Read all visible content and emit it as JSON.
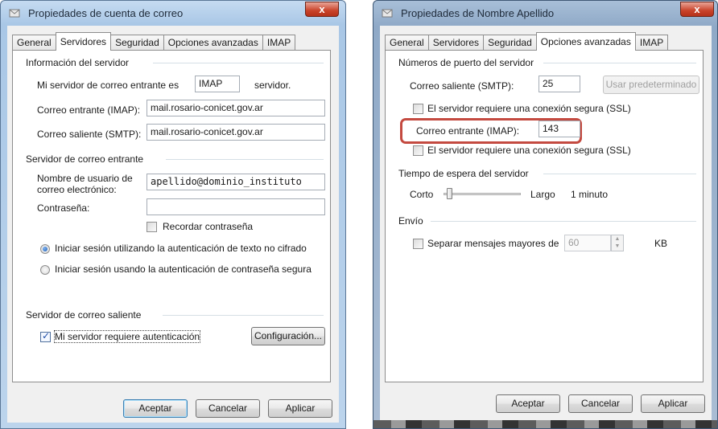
{
  "left_window": {
    "title": "Propiedades de cuenta de correo",
    "close_glyph": "x",
    "tabs": [
      {
        "label": "General",
        "active": false
      },
      {
        "label": "Servidores",
        "active": true
      },
      {
        "label": "Seguridad",
        "active": false
      },
      {
        "label": "Opciones avanzadas",
        "active": false
      },
      {
        "label": "IMAP",
        "active": false
      }
    ],
    "server_info_group": "Información del servidor",
    "incoming_type_label": "Mi servidor de correo entrante es",
    "incoming_type_value": "IMAP",
    "incoming_type_suffix": "servidor.",
    "incoming_imap_label": "Correo entrante (IMAP):",
    "incoming_imap_value": "mail.rosario-conicet.gov.ar",
    "outgoing_smtp_label": "Correo saliente (SMTP):",
    "outgoing_smtp_value": "mail.rosario-conicet.gov.ar",
    "incoming_server_group": "Servidor de correo entrante",
    "username_label_1": "Nombre de usuario de",
    "username_label_2": "correo electrónico:",
    "username_value": "apellido@dominio_instituto",
    "password_label": "Contraseña:",
    "password_value": "",
    "remember_password_label": "Recordar contraseña",
    "remember_password_checked": false,
    "radio_plain_label": "Iniciar sesión utilizando la autenticación de texto no cifrado",
    "radio_plain_selected": true,
    "radio_secure_label": "Iniciar sesión usando la autenticación de contraseña segura",
    "radio_secure_selected": false,
    "outgoing_server_group": "Servidor de correo saliente",
    "requires_auth_label": "Mi servidor requiere autenticación",
    "requires_auth_checked": true,
    "config_button": "Configuración...",
    "ok_button": "Aceptar",
    "cancel_button": "Cancelar",
    "apply_button": "Aplicar"
  },
  "right_window": {
    "title": "Propiedades de Nombre Apellido",
    "close_glyph": "x",
    "tabs": [
      {
        "label": "General",
        "active": false
      },
      {
        "label": "Servidores",
        "active": false
      },
      {
        "label": "Seguridad",
        "active": false
      },
      {
        "label": "Opciones avanzadas",
        "active": true
      },
      {
        "label": "IMAP",
        "active": false
      }
    ],
    "ports_group": "Números de puerto del servidor",
    "smtp_label": "Correo saliente (SMTP):",
    "smtp_port": "25",
    "use_default_button": "Usar predeterminado",
    "smtp_ssl_label": "El servidor requiere una conexión segura (SSL)",
    "smtp_ssl_checked": false,
    "imap_label": "Correo entrante (IMAP):",
    "imap_port": "143",
    "imap_ssl_label": "El servidor requiere una conexión segura (SSL)",
    "imap_ssl_checked": false,
    "timeout_group": "Tiempo de espera del servidor",
    "timeout_short": "Corto",
    "timeout_long": "Largo",
    "timeout_value": "1 minuto",
    "timeout_level": 0.05,
    "sending_group": "Envío",
    "split_messages_label": "Separar mensajes mayores de",
    "split_messages_checked": false,
    "split_size": "60",
    "split_unit": "KB",
    "ok_button": "Aceptar",
    "cancel_button": "Cancelar",
    "apply_button": "Aplicar"
  },
  "colors": {
    "highlight_box": "#c44a40",
    "close_button": "#c9432a"
  }
}
